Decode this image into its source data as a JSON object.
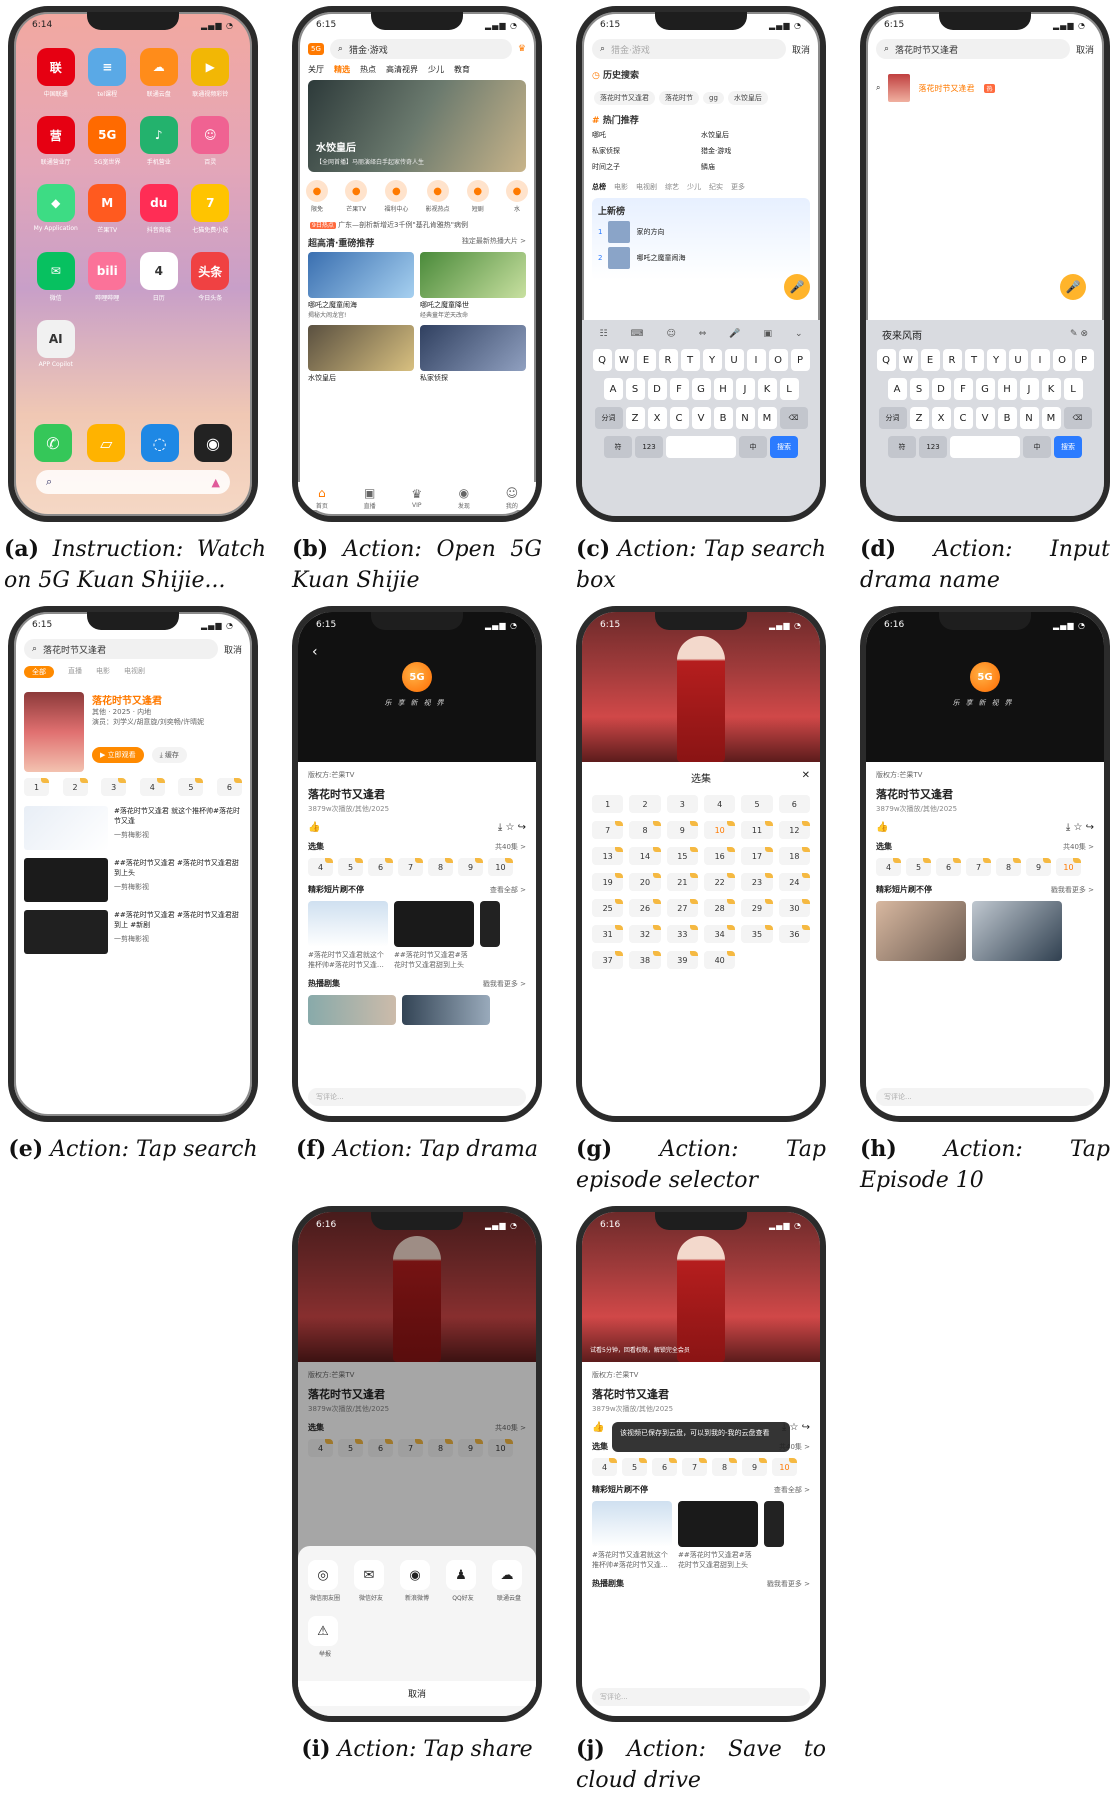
{
  "captions": [
    {
      "letter": "(a)",
      "text": "Instruction: Watch on 5G Kuan Shijie..."
    },
    {
      "letter": "(b)",
      "text": "Action: Open 5G Kuan Shijie"
    },
    {
      "letter": "(c)",
      "text": "Action: Tap search box"
    },
    {
      "letter": "(d)",
      "text": "Action: Input drama name"
    },
    {
      "letter": "(e)",
      "text": "Action: Tap search"
    },
    {
      "letter": "(f)",
      "text": "Action: Tap drama"
    },
    {
      "letter": "(g)",
      "text": "Action: Tap episode selector"
    },
    {
      "letter": "(h)",
      "text": "Action: Tap Episode 10"
    },
    {
      "letter": "(i)",
      "text": "Action: Tap share"
    },
    {
      "letter": "(j)",
      "text": "Action: Save to cloud drive"
    }
  ],
  "times": {
    "a": "6:14",
    "b": "6:15",
    "c": "6:15",
    "d": "6:15",
    "e": "6:15",
    "f": "6:15",
    "g": "6:15",
    "h": "6:16",
    "i": "6:16",
    "j": "6:16"
  },
  "home": {
    "apps": [
      {
        "label": "中国联通",
        "glyph": "联",
        "color": "#e60012"
      },
      {
        "label": "tel课程",
        "glyph": "≡",
        "color": "#5aa9e6"
      },
      {
        "label": "联通云盘",
        "glyph": "☁",
        "color": "#ff8c1a"
      },
      {
        "label": "联通视频彩铃",
        "glyph": "▶",
        "color": "#f2b705"
      },
      {
        "label": "联通营业厅",
        "glyph": "营",
        "color": "#e60012"
      },
      {
        "label": "5G宽世界",
        "glyph": "5G",
        "color": "#ff6a00"
      },
      {
        "label": "手机营业",
        "glyph": "♪",
        "color": "#23b26d"
      },
      {
        "label": "百灵",
        "glyph": "☺",
        "color": "#f06292"
      },
      {
        "label": "My Application",
        "glyph": "◆",
        "color": "#3ddc84"
      },
      {
        "label": "芒果TV",
        "glyph": "M",
        "color": "#ff5a1f"
      },
      {
        "label": "抖音商城",
        "glyph": "du",
        "color": "#ff2d55"
      },
      {
        "label": "七猫免费小说",
        "glyph": "7",
        "color": "#ffc400"
      },
      {
        "label": "微信",
        "glyph": "✉",
        "color": "#07c160"
      },
      {
        "label": "哔哩哔哩",
        "glyph": "bili",
        "color": "#fb7299"
      },
      {
        "label": "日历",
        "glyph": "4",
        "color": "#ffffff"
      },
      {
        "label": "今日头条",
        "glyph": "头条",
        "color": "#f04142"
      },
      {
        "label": "APP Copilot",
        "glyph": "AI",
        "color": "#f1f1f1"
      }
    ]
  },
  "b": {
    "search": "猎金·游戏",
    "tabs": [
      "关厅",
      "精选",
      "热点",
      "高清视界",
      "少儿",
      "教育"
    ],
    "banner_title": "水饺皇后",
    "banner_sub": "【全网首播】马丽演绎白手起家传奇人生",
    "icons": [
      "限免",
      "芒果TV",
      "福利中心",
      "影视热点",
      "短剧",
      "水"
    ],
    "notice": "广东—剖析新增近3千例\"基孔肯雅热\"病例",
    "section": "超高清·重磅推荐",
    "section_more": "独定最新热播大片 >",
    "movies": [
      {
        "title": "哪吒之魔童闹海",
        "sub": "揭秘大闹龙宫!"
      },
      {
        "title": "哪吒之魔童降世",
        "sub": "经典童年逆天改命"
      },
      {
        "title": "水饺皇后",
        "sub": ""
      },
      {
        "title": "私家侦探",
        "sub": ""
      }
    ],
    "tabbar": [
      "首页",
      "直播",
      "VIP",
      "发现",
      "我的"
    ]
  },
  "c": {
    "placeholder": "猎金·游戏",
    "cancel": "取消",
    "history_title": "历史搜索",
    "history": [
      "落花时节又逢君",
      "落花时节",
      "gg",
      "水饺皇后"
    ],
    "hot_title": "热门推荐",
    "hot": [
      "哪吒",
      "水饺皇后",
      "私家侦探",
      "猎金·游戏",
      "时间之子",
      "鳞庙"
    ],
    "rank_tabs": [
      "总榜",
      "电影",
      "电视剧",
      "综艺",
      "少儿",
      "纪实",
      "更多"
    ],
    "rank_title": "上新榜",
    "rank_items": [
      "家的方向",
      "哪吒之魔童闹海"
    ]
  },
  "d": {
    "query": "落花时节又逢君",
    "suggestion": "落花时节又逢君",
    "candidate": "夜来风雨",
    "cancel": "取消"
  },
  "keyboard": {
    "row1": [
      "Q",
      "W",
      "E",
      "R",
      "T",
      "Y",
      "U",
      "I",
      "O",
      "P"
    ],
    "row2": [
      "A",
      "S",
      "D",
      "F",
      "G",
      "H",
      "J",
      "K",
      "L"
    ],
    "row3": [
      "分词",
      "Z",
      "X",
      "C",
      "V",
      "B",
      "N",
      "M",
      "⌫"
    ],
    "row4": [
      "符",
      "123",
      "␣",
      "中",
      "搜索"
    ]
  },
  "e": {
    "query": "落花时节又逢君",
    "filters": [
      "全部",
      "直播",
      "电影",
      "电视剧"
    ],
    "title": "落花时节又逢君",
    "meta": "其他 · 2025 · 内地",
    "cast": "演员：刘学义/胡意旋/刘奕畅/许晴妮",
    "play": "立即观看",
    "cache": "缓存",
    "episodes": [
      "1",
      "2",
      "3",
      "4",
      "5",
      "6"
    ],
    "clips": [
      "#落花时节又逢君 就这个推杯帅#落花时节又逢",
      "##落花时节又逢君 #落花时节又逢君甜到上头",
      "##落花时节又逢君 #落花时节又逢君甜到上 #新剧"
    ],
    "source": "一剪梅影视",
    "cancel": "取消"
  },
  "detail": {
    "brand": "5G",
    "slogan": "乐享新视界",
    "copyright": "版权方:芒果TV",
    "title": "落花时节又逢君",
    "meta": "3879w次播放/其他/2025",
    "select": "选集",
    "total": "共40集 >",
    "episodes": [
      "4",
      "5",
      "6",
      "7",
      "8",
      "9",
      "10"
    ],
    "short_title": "精彩短片刷不停",
    "short_more": "查看全部 >",
    "clips": [
      "#落花时节又逢君就这个推杯帅#落花时节又逢…",
      "##落花时节又逢君#落花时节又逢君甜到上头"
    ],
    "hot_title": "热播剧集",
    "hot_more": "戳我看更多 >",
    "comment": "写评论...",
    "trial": "试看5分钟，回看权限，解锁完全会员"
  },
  "g": {
    "title": "选集",
    "episodes": [
      "1",
      "2",
      "3",
      "4",
      "5",
      "6",
      "7",
      "8",
      "9",
      "10",
      "11",
      "12",
      "13",
      "14",
      "15",
      "16",
      "17",
      "18",
      "19",
      "20",
      "21",
      "22",
      "23",
      "24",
      "25",
      "26",
      "27",
      "28",
      "29",
      "30",
      "31",
      "32",
      "33",
      "34",
      "35",
      "36",
      "37",
      "38",
      "39",
      "40"
    ]
  },
  "i": {
    "share_items": [
      {
        "label": "微信朋友圈",
        "glyph": "◎"
      },
      {
        "label": "微信好友",
        "glyph": "✉"
      },
      {
        "label": "新浪微博",
        "glyph": "◉"
      },
      {
        "label": "QQ好友",
        "glyph": "♟"
      },
      {
        "label": "联通云盘",
        "glyph": "☁"
      }
    ],
    "report": "举报",
    "cancel": "取消"
  },
  "j": {
    "toast": "该视频已保存到云盘，可以到我的-我的云盘查看"
  }
}
